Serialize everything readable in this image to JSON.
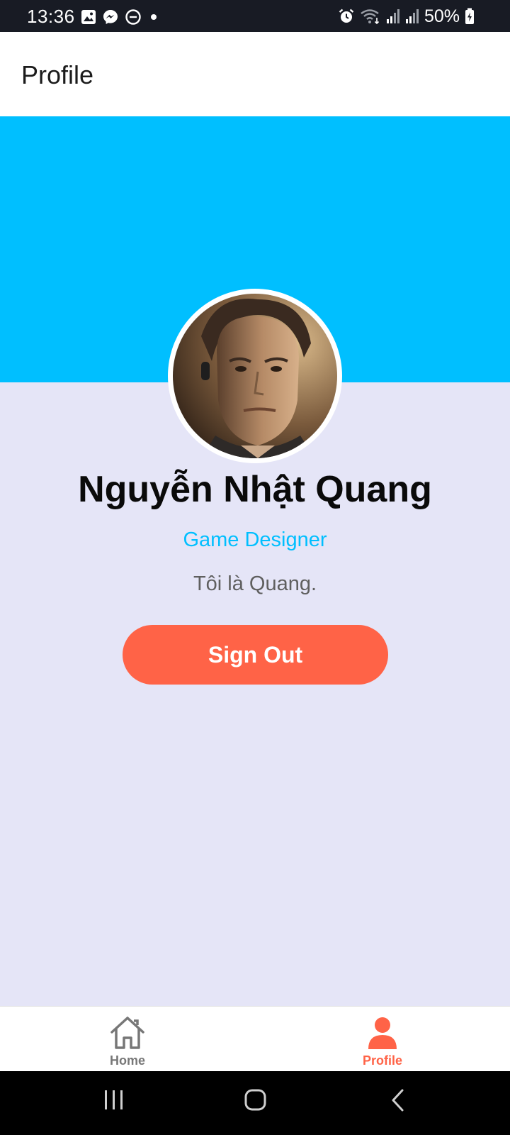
{
  "status_bar": {
    "time": "13:36",
    "battery": "50%",
    "left_icons": [
      "image-icon",
      "messenger-icon",
      "do-not-disturb-icon",
      "dot-icon"
    ],
    "right_icons": [
      "alarm-icon",
      "wifi-icon",
      "signal-icon",
      "signal-icon",
      "battery-icon"
    ]
  },
  "app_bar": {
    "title": "Profile"
  },
  "profile": {
    "name": "Nguyễn Nhật Quang",
    "job_title": "Game Designer",
    "bio": "Tôi là Quang.",
    "sign_out_label": "Sign Out",
    "cover_color": "#00bfff",
    "accent_color": "#00bfff",
    "button_color": "#ff6347"
  },
  "tab_bar": {
    "tabs": [
      {
        "label": "Home",
        "icon": "home-icon",
        "active": false
      },
      {
        "label": "Profile",
        "icon": "person-icon",
        "active": true
      }
    ],
    "active_color": "#ff6347",
    "inactive_color": "#777777"
  },
  "nav_bar": {
    "buttons": [
      "recent-apps-icon",
      "home-circle-icon",
      "back-icon"
    ]
  }
}
